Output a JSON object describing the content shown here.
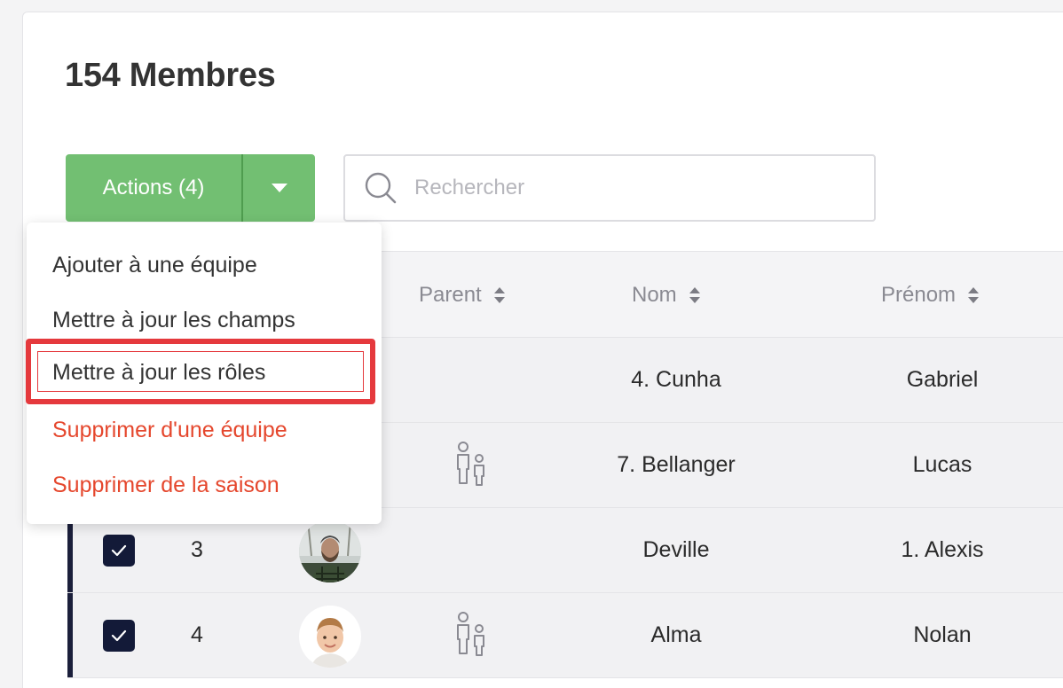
{
  "page": {
    "title": "154 Membres"
  },
  "toolbar": {
    "actions_label": "Actions (4)",
    "search_placeholder": "Rechercher"
  },
  "table": {
    "columns": [
      "Parent",
      "Nom",
      "Prénom"
    ],
    "rows": [
      {
        "nom": "4. Cunha",
        "prenom": "Gabriel",
        "has_parent": false
      },
      {
        "nom": "7. Bellanger",
        "prenom": "Lucas",
        "has_parent": true
      },
      {
        "num": "3",
        "nom": "Deville",
        "prenom": "1. Alexis",
        "has_parent": false,
        "checked": true
      },
      {
        "num": "4",
        "nom": "Alma",
        "prenom": "Nolan",
        "has_parent": true,
        "checked": true
      }
    ]
  },
  "dropdown": {
    "items": [
      {
        "label": "Ajouter à une équipe",
        "danger": false
      },
      {
        "label": "Mettre à jour les champs",
        "danger": false
      },
      {
        "label": "Mettre à jour les rôles",
        "danger": false,
        "highlighted": true
      },
      {
        "label": "Supprimer d'une équipe",
        "danger": true
      },
      {
        "label": "Supprimer de la saison",
        "danger": true
      }
    ]
  },
  "colors": {
    "primary_button": "#72bf72",
    "danger_text": "#e5472d",
    "highlight": "#e5393d",
    "selection_bar": "#1b1f3b"
  },
  "icons": [
    "chevron-down-icon",
    "search-icon",
    "sort-icon",
    "checkmark-icon",
    "parent-icon"
  ]
}
